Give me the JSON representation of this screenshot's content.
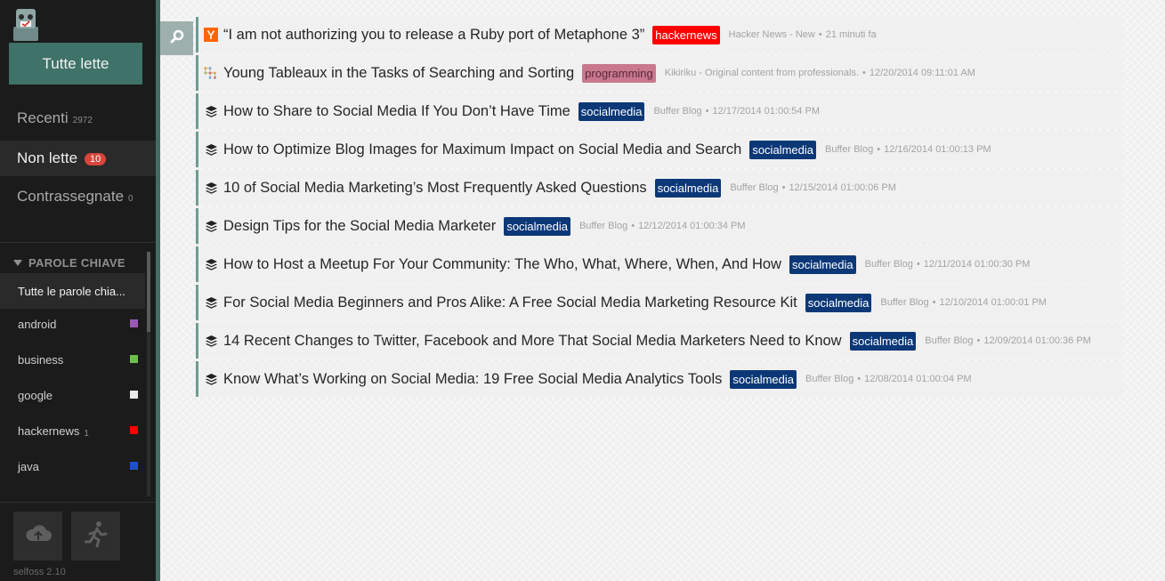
{
  "sidebar": {
    "mark_all_label": "Tutte lette",
    "filters": [
      {
        "label": "Recenti",
        "count": "2972"
      },
      {
        "label": "Non lette",
        "badge": "10"
      },
      {
        "label": "Contrassegnate",
        "count": "0"
      }
    ],
    "tags_header": "PAROLE CHIAVE",
    "tags": [
      {
        "label": "Tutte le parole chia...",
        "count": "",
        "color": ""
      },
      {
        "label": "android",
        "count": "",
        "color": "#9b59b6"
      },
      {
        "label": "business",
        "count": "",
        "color": "#6abf4b"
      },
      {
        "label": "google",
        "count": "",
        "color": "#e8e8e8"
      },
      {
        "label": "hackernews",
        "count": "1",
        "color": "#ff0000"
      },
      {
        "label": "java",
        "count": "",
        "color": "#1f4fd1"
      }
    ],
    "version": "selfoss 2.10",
    "buttons": {
      "refresh_icon": "cloud-upload-icon",
      "logout_icon": "running-person-icon"
    }
  },
  "main": {
    "search_icon": "magnifier-icon",
    "items": [
      {
        "icon": "hn-icon",
        "title": "“I am not authorizing you to release a Ruby port of Metaphone 3”",
        "tag": "hackernews",
        "tag_color": "#ff0000",
        "source": "Hacker News - New",
        "date": "21 minuti fa"
      },
      {
        "icon": "kikiriku-icon",
        "title": "Young Tableaux in the Tasks of Searching and Sorting",
        "tag": "programming",
        "tag_color": "#c9788e",
        "tag_text_color": "#5a2a3a",
        "source": "Kikiriku - Original content from professionals.",
        "date": "12/20/2014 09:11:01 AM"
      },
      {
        "icon": "buffer-icon",
        "title": "How to Share to Social Media If You Don’t Have Time",
        "tag": "socialmedia",
        "tag_color": "#0c3878",
        "source": "Buffer Blog",
        "date": "12/17/2014 01:00:54 PM"
      },
      {
        "icon": "buffer-icon",
        "title": "How to Optimize Blog Images for Maximum Impact on Social Media and Search",
        "tag": "socialmedia",
        "tag_color": "#0c3878",
        "source": "Buffer Blog",
        "date": "12/16/2014 01:00:13 PM"
      },
      {
        "icon": "buffer-icon",
        "title": "10 of Social Media Marketing’s Most Frequently Asked Questions",
        "tag": "socialmedia",
        "tag_color": "#0c3878",
        "source": "Buffer Blog",
        "date": "12/15/2014 01:00:06 PM"
      },
      {
        "icon": "buffer-icon",
        "title": "Design Tips for the Social Media Marketer",
        "tag": "socialmedia",
        "tag_color": "#0c3878",
        "source": "Buffer Blog",
        "date": "12/12/2014 01:00:34 PM"
      },
      {
        "icon": "buffer-icon",
        "title": "How to Host a Meetup For Your Community: The Who, What, Where, When, And How",
        "tag": "socialmedia",
        "tag_color": "#0c3878",
        "source": "Buffer Blog",
        "date": "12/11/2014 01:00:30 PM"
      },
      {
        "icon": "buffer-icon",
        "title": "For Social Media Beginners and Pros Alike: A Free Social Media Marketing Resource Kit",
        "tag": "socialmedia",
        "tag_color": "#0c3878",
        "source": "Buffer Blog",
        "date": "12/10/2014 01:00:01 PM"
      },
      {
        "icon": "buffer-icon",
        "title": "14 Recent Changes to Twitter, Facebook and More That Social Media Marketers Need to Know",
        "tag": "socialmedia",
        "tag_color": "#0c3878",
        "source": "Buffer Blog",
        "date": "12/09/2014 01:00:36 PM"
      },
      {
        "icon": "buffer-icon",
        "title": "Know What’s Working on Social Media: 19 Free Social Media Analytics Tools",
        "tag": "socialmedia",
        "tag_color": "#0c3878",
        "source": "Buffer Blog",
        "date": "12/08/2014 01:00:04 PM"
      }
    ]
  }
}
